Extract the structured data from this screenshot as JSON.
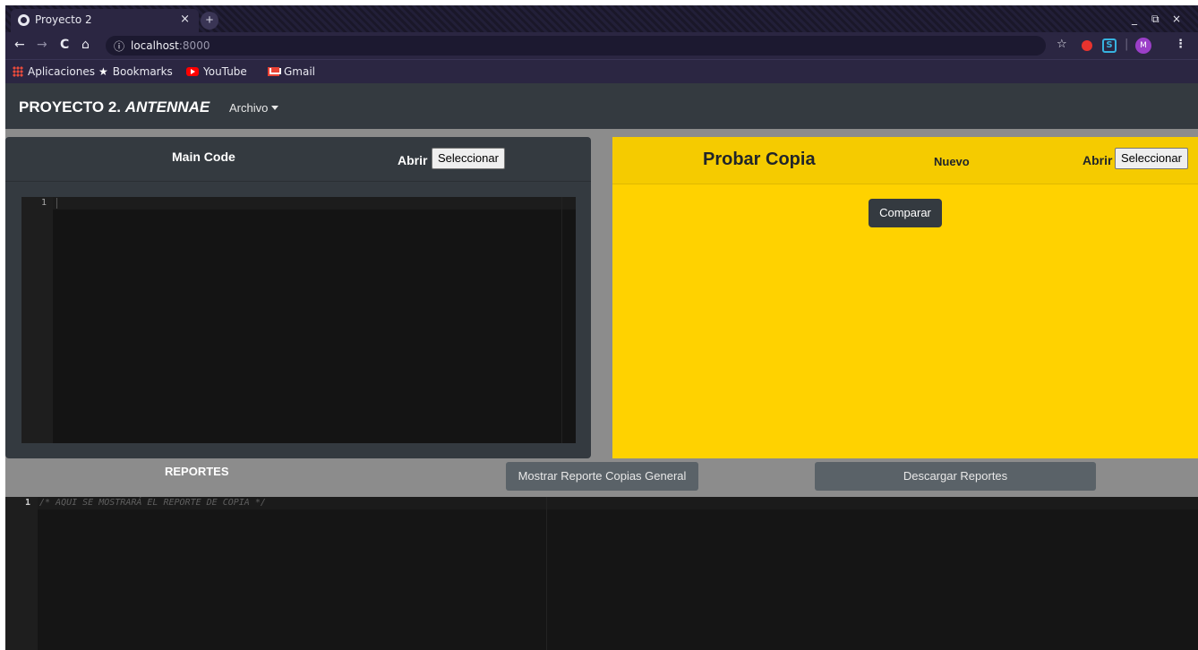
{
  "browser": {
    "tab_title": "Proyecto 2",
    "tab_close": "×",
    "new_tab": "+",
    "window_controls": [
      "_",
      "⧉",
      "×"
    ],
    "url_host": "localhost",
    "url_port": ":8000",
    "info_icon": "ⓘ",
    "nav": {
      "back": "←",
      "forward": "→",
      "reload": "C",
      "home": "⌂"
    },
    "extensions": {
      "star": "☆",
      "s_ext": "S",
      "avatar": "M",
      "menu": "⋮"
    },
    "bookmarks": [
      {
        "label": "Aplicaciones",
        "icon": "apps-grid-icon"
      },
      {
        "label": "Bookmarks",
        "icon": "star-icon"
      },
      {
        "label": "YouTube",
        "icon": "youtube-icon"
      },
      {
        "label": "Gmail",
        "icon": "gmail-icon"
      }
    ]
  },
  "app": {
    "brand_prefix": "PROYECTO 2.",
    "brand_italic": "ANTENNAE",
    "archivo_menu": "Archivo",
    "main_card": {
      "title": "Main Code",
      "abrir": "Abrir",
      "select_label": "Seleccionar",
      "line_number": "1"
    },
    "copy_card": {
      "title": "Probar Copia",
      "nuevo": "Nuevo",
      "abrir": "Abrir",
      "select_label": "Seleccionar",
      "compare_button": "Comparar"
    },
    "reports": {
      "title": "REPORTES",
      "show_general_button": "Mostrar Reporte Copias General",
      "download_button": "Descargar Reportes",
      "line_number": "1",
      "placeholder_code": "/* AQUI SE MOSTRARÁ EL REPORTE DE COPIA */"
    }
  },
  "colors": {
    "dark_panel": "#343a40",
    "yellow_panel": "#ffd200",
    "page_grey": "#8c8c8c",
    "editor_bg": "#141414",
    "browser_chrome": "#2b2642"
  }
}
